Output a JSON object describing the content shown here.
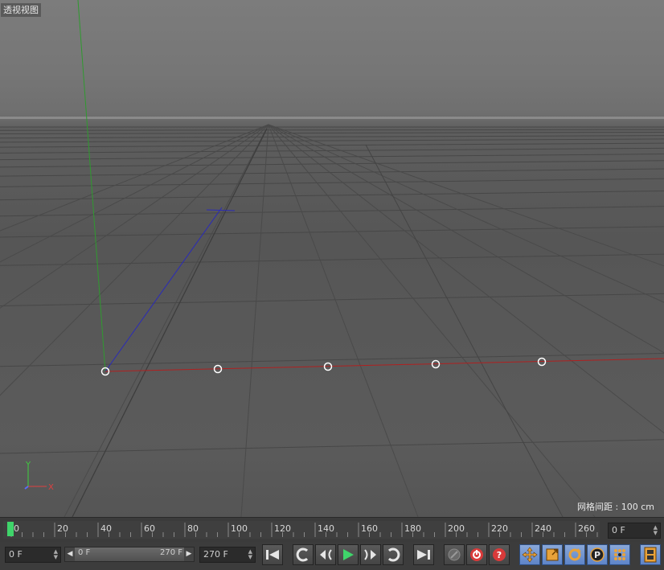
{
  "viewport": {
    "title": "透视视图",
    "grid_info": "网格间距 : 100 cm",
    "axis_gizmo": {
      "y_label": "Y",
      "x_label": "X"
    }
  },
  "timeline": {
    "ticks": [
      "0",
      "20",
      "40",
      "60",
      "80",
      "100",
      "120",
      "140",
      "160",
      "180",
      "200",
      "220",
      "240",
      "260"
    ],
    "current_frame": "0 F"
  },
  "controls": {
    "start_frame": "0 F",
    "range_start": "0 F",
    "range_end": "270 F",
    "end_frame": "270 F",
    "icons": {
      "go_start": "go-to-start-icon",
      "prev_key": "previous-keyframe-icon",
      "step_back": "step-back-icon",
      "play": "play-icon",
      "step_forward": "step-forward-icon",
      "next_key": "next-keyframe-icon",
      "go_end": "go-to-end-icon",
      "record_disabled": "record-disabled-icon",
      "autokey": "autokey-icon",
      "keyframe_help": "keyframe-help-icon",
      "move": "move-icon",
      "scale": "scale-icon",
      "rotate": "rotate-icon",
      "param": "parameter-icon",
      "pla": "pla-icon",
      "film": "film-icon"
    },
    "accent_color": "#e8a23a",
    "play_color": "#3fd46a"
  }
}
